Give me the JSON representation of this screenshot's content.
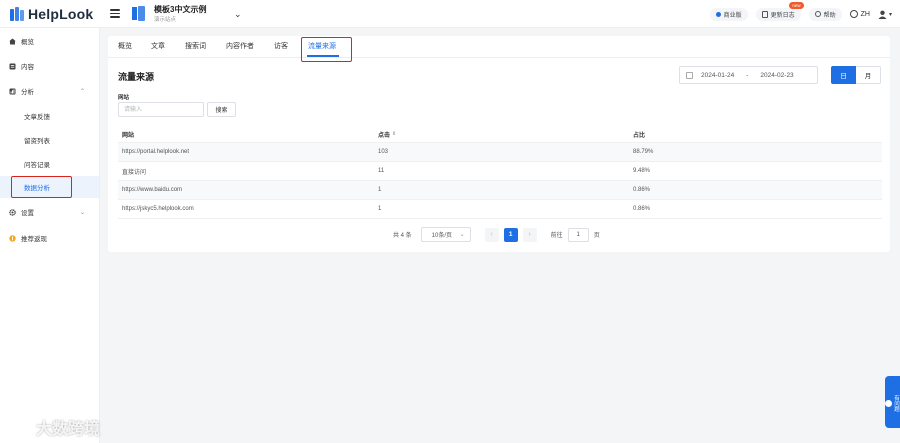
{
  "app": {
    "logo_text": "HelpLook",
    "site_title": "模板3中文示例",
    "site_subtitle": "演示站点"
  },
  "topbar": {
    "plan_label": "商业版",
    "changelog_label": "更新日志",
    "new_badge": "new",
    "help_label": "帮助",
    "language": "ZH"
  },
  "sidebar": {
    "items": [
      {
        "label": "概览"
      },
      {
        "label": "内容"
      },
      {
        "label": "分析"
      },
      {
        "label": "文章反馈"
      },
      {
        "label": "留资列表"
      },
      {
        "label": "问答记录"
      },
      {
        "label": "数据分析"
      },
      {
        "label": "设置"
      },
      {
        "label": "推荐返现"
      }
    ]
  },
  "tabs": [
    {
      "label": "概览"
    },
    {
      "label": "文章"
    },
    {
      "label": "搜索词"
    },
    {
      "label": "内容作者"
    },
    {
      "label": "访客"
    },
    {
      "label": "流量来源"
    }
  ],
  "section": {
    "title": "流量来源",
    "date_start": "2024-01-24",
    "date_sep": "-",
    "date_end": "2024-02-23",
    "range_day": "日",
    "range_month": "月"
  },
  "filter": {
    "label": "网站",
    "placeholder": "请输入",
    "search_button": "搜索"
  },
  "table": {
    "headers": [
      "网站",
      "点击",
      "占比"
    ],
    "sort_icon": "⇕",
    "rows": [
      [
        "https://portal.helplook.net",
        "103",
        "88.79%"
      ],
      [
        "直接访问",
        "11",
        "9.48%"
      ],
      [
        "https://www.baidu.com",
        "1",
        "0.86%"
      ],
      [
        "https://jskyc5.helplook.com",
        "1",
        "0.86%"
      ]
    ]
  },
  "pagination": {
    "total_text": "共 4 条",
    "page_size": "10条/页",
    "prev": "‹",
    "current_page": "1",
    "next": "›",
    "goto_label": "前往",
    "goto_value": "1",
    "page_unit": "页"
  },
  "feedback": {
    "label": "有问题"
  },
  "watermark": {
    "text": "大数跨境"
  },
  "colors": {
    "accent": "#1e6fe3",
    "highlight_red": "#d9251c",
    "badge_orange": "#f2592d"
  }
}
